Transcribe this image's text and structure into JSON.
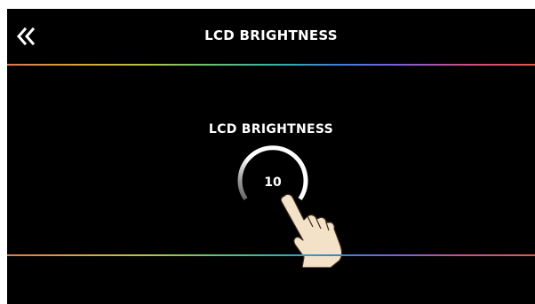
{
  "header": {
    "title": "LCD BRIGHTNESS",
    "back_icon": "double-chevron-left-icon"
  },
  "parameter": {
    "label": "LCD BRIGHTNESS",
    "value": "10"
  },
  "colors": {
    "background": "#000000",
    "text": "#ffffff",
    "knob_arc": "#ffffff"
  },
  "gesture": {
    "icon": "tapping-hand-icon"
  }
}
